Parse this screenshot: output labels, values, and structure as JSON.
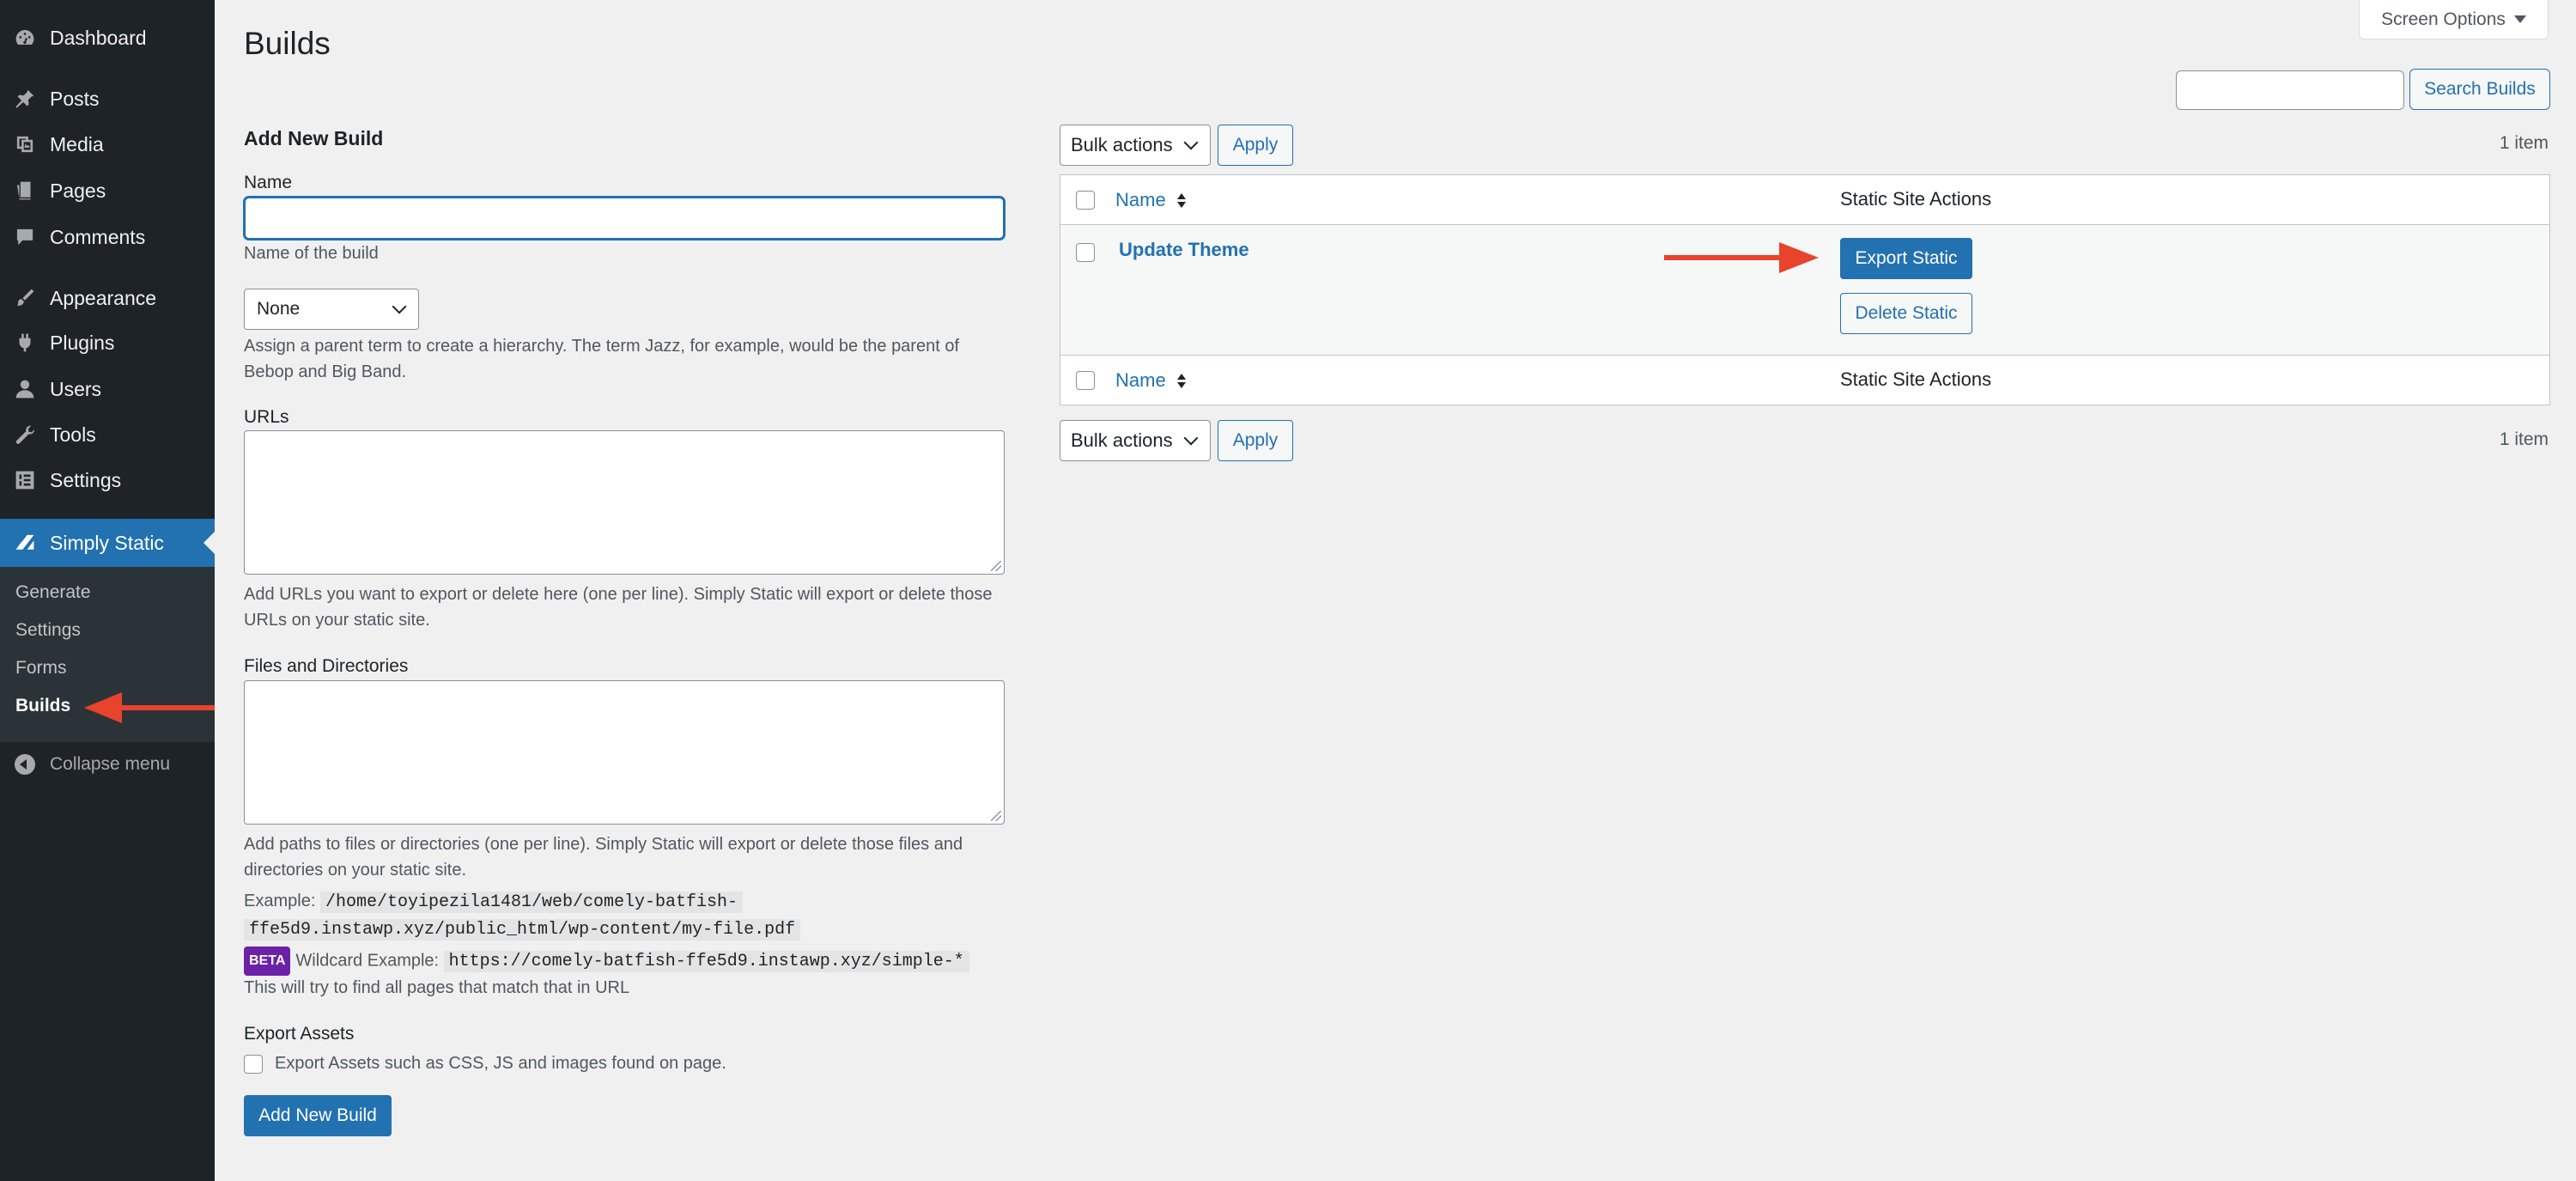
{
  "sidebar": {
    "items": [
      {
        "label": "Dashboard",
        "icon": "dashboard-icon"
      },
      {
        "label": "Posts",
        "icon": "pin-icon"
      },
      {
        "label": "Media",
        "icon": "media-icon"
      },
      {
        "label": "Pages",
        "icon": "pages-icon"
      },
      {
        "label": "Comments",
        "icon": "comments-icon"
      },
      {
        "label": "Appearance",
        "icon": "brush-icon"
      },
      {
        "label": "Plugins",
        "icon": "plugin-icon"
      },
      {
        "label": "Users",
        "icon": "user-icon"
      },
      {
        "label": "Tools",
        "icon": "wrench-icon"
      },
      {
        "label": "Settings",
        "icon": "settings-icon"
      },
      {
        "label": "Simply Static",
        "icon": "simply-static-icon"
      }
    ],
    "submenu": [
      "Generate",
      "Settings",
      "Forms",
      "Builds"
    ],
    "collapse_label": "Collapse menu"
  },
  "header": {
    "title": "Builds",
    "screen_options": "Screen Options",
    "search_button": "Search Builds"
  },
  "form": {
    "heading": "Add New Build",
    "name_label": "Name",
    "name_help": "Name of the build",
    "parent_value": "None",
    "parent_help": "Assign a parent term to create a hierarchy. The term Jazz, for example, would be the parent of Bebop and Big Band.",
    "urls_label": "URLs",
    "urls_help": "Add URLs you want to export or delete here (one per line). Simply Static will export or delete those URLs on your static site.",
    "files_label": "Files and Directories",
    "files_help": "Add paths to files or directories (one per line). Simply Static will export or delete those files and directories on your static site.",
    "example_label": "Example:",
    "example_path_1": "/home/toyipezila1481/web/comely-batfish-",
    "example_path_2": "ffe5d9.instawp.xyz/public_html/wp-content/my-file.pdf",
    "beta_label": "BETA",
    "wildcard_label": "Wildcard Example:",
    "wildcard_value": "https://comely-batfish-ffe5d9.instawp.xyz/simple-*",
    "wildcard_help": "This will try to find all pages that match that in URL",
    "assets_label": "Export Assets",
    "assets_checkbox": "Export Assets such as CSS, JS and images found on page.",
    "submit": "Add New Build"
  },
  "table": {
    "bulk_actions": "Bulk actions",
    "apply": "Apply",
    "item_count": "1 item",
    "col_name": "Name",
    "col_actions": "Static Site Actions",
    "rows": [
      {
        "title": "Update Theme",
        "export": "Export Static",
        "delete": "Delete Static"
      }
    ]
  },
  "colors": {
    "sidebar_bg": "#1d2327",
    "accent": "#2271b1",
    "annotation_arrow": "#e8432d",
    "beta_badge": "#6b21a8"
  }
}
